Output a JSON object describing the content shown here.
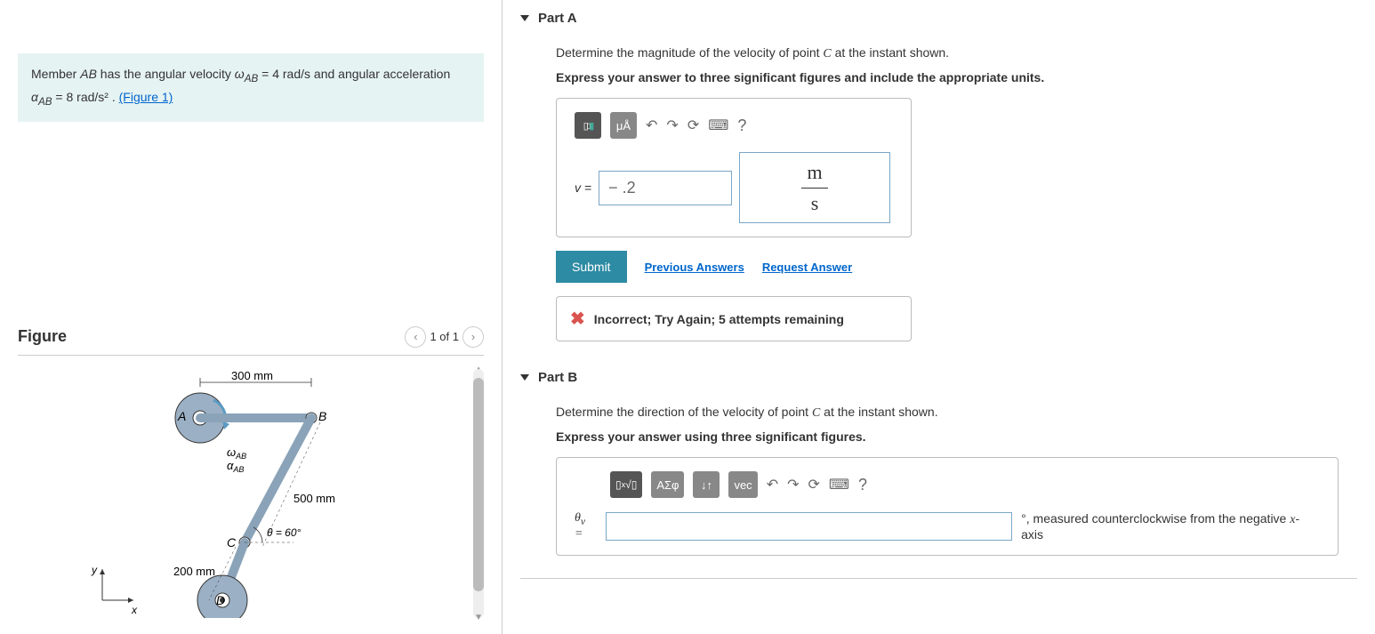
{
  "problem": {
    "text_prefix": "Member ",
    "ab": "AB",
    "text_mid1": " has the angular velocity ",
    "omega": "ω",
    "sub_ab": "AB",
    "eq1": " = 4  rad/s",
    "text_mid2": " and angular acceleration ",
    "alpha": "α",
    "eq2": " = 8  rad/s²",
    "text_end": " . ",
    "figure_link": "(Figure 1)"
  },
  "figure": {
    "heading": "Figure",
    "counter": "1 of 1",
    "labels": {
      "dim_300": "300 mm",
      "dim_500": "500 mm",
      "dim_200": "200 mm",
      "A": "A",
      "B": "B",
      "C": "C",
      "D": "D",
      "omega_ab": "ω",
      "alpha_ab": "α",
      "sub": "AB",
      "theta": "θ = 60°",
      "x": "x",
      "y": "y"
    }
  },
  "partA": {
    "title": "Part A",
    "question_pre": "Determine the magnitude of the velocity of point ",
    "point": "C",
    "question_post": " at the instant shown.",
    "instruction": "Express your answer to three significant figures and include the appropriate units.",
    "toolbar": {
      "units_btn": "▯▯",
      "ma_btn": "μÅ",
      "undo": "↶",
      "redo": "↷",
      "reset": "⟳",
      "keyboard": "⌨",
      "help": "?"
    },
    "var": "v =",
    "value": "− .2",
    "unit_num": "m",
    "unit_den": "s",
    "submit": "Submit",
    "prev_answers": "Previous Answers",
    "request_answer": "Request Answer",
    "feedback": "Incorrect; Try Again; 5 attempts remaining"
  },
  "partB": {
    "title": "Part B",
    "question_pre": "Determine the direction of the velocity of point ",
    "point": "C",
    "question_post": " at the instant shown.",
    "instruction": "Express your answer using three significant figures.",
    "toolbar": {
      "sqrt_btn": "√",
      "greek_btn": "ΑΣφ",
      "updown": "↓↑",
      "vec": "vec",
      "undo": "↶",
      "redo": "↷",
      "reset": "⟳",
      "keyboard": "⌨",
      "help": "?"
    },
    "var_theta": "θ",
    "var_sub": "v",
    "eq": " =",
    "suffix_deg": "°",
    "suffix_text": ", measured counterclockwise from the negative ",
    "suffix_x": "x",
    "suffix_axis": "-axis"
  }
}
